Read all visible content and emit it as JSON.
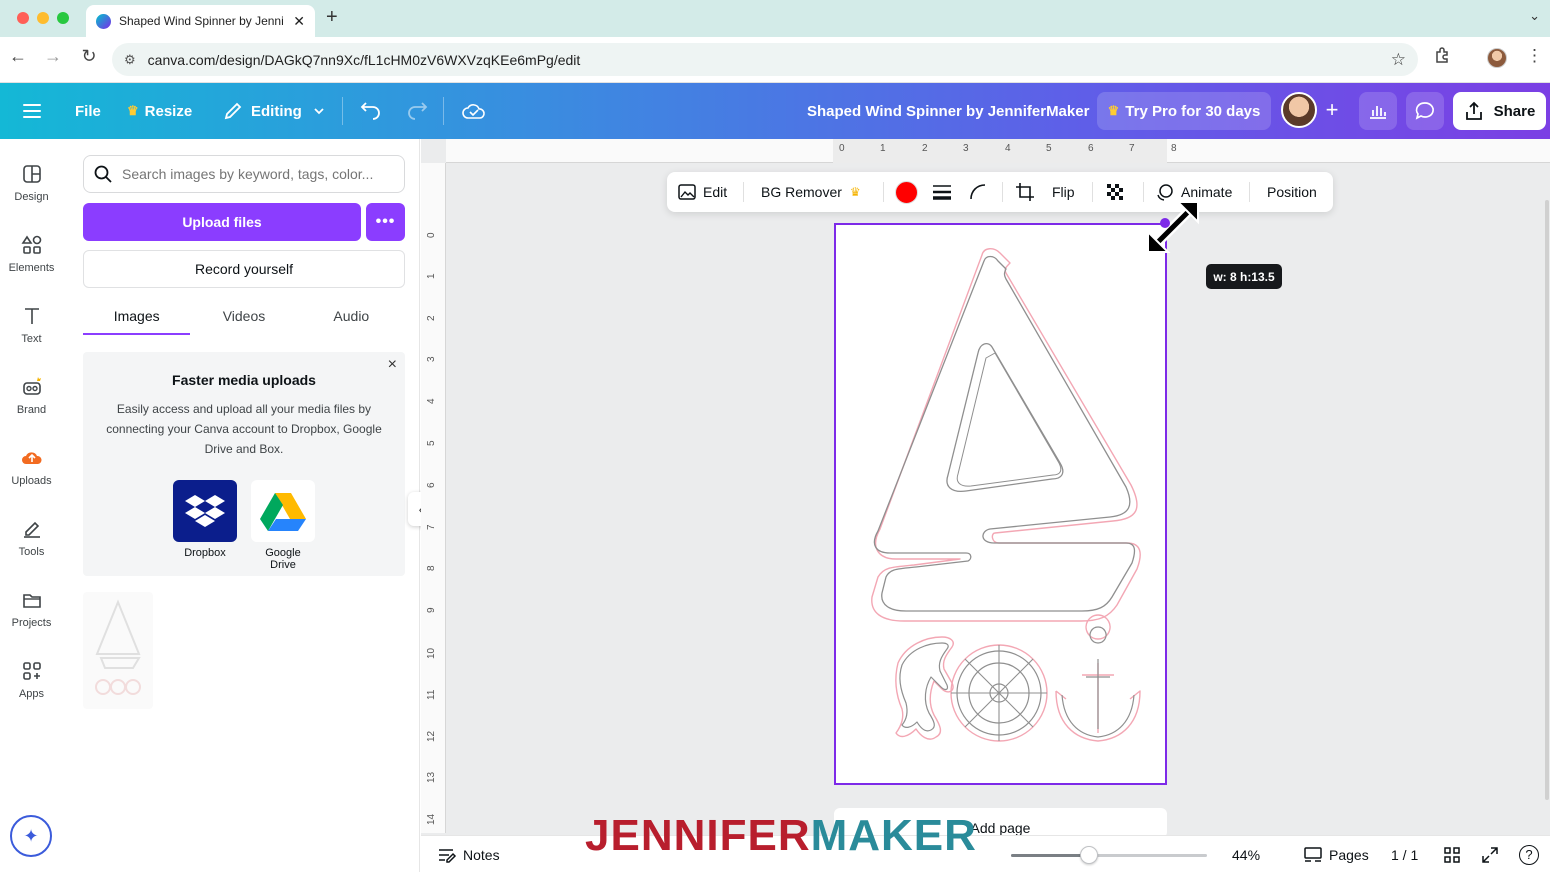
{
  "browser": {
    "tab_title": "Shaped Wind Spinner by Jenni",
    "new_tab": "+",
    "url": "canva.com/design/DAGkQ7nn9Xc/fL1cHM0zV6WXVzqKEe6mPg/edit"
  },
  "toolbar": {
    "file": "File",
    "resize": "Resize",
    "editing": "Editing",
    "doc_title": "Shaped Wind Spinner by JenniferMaker",
    "try_pro": "Try Pro for 30 days",
    "plus": "+",
    "share": "Share"
  },
  "rail": {
    "items": [
      {
        "label": "Design",
        "icon": "layout-icon"
      },
      {
        "label": "Elements",
        "icon": "shapes-icon"
      },
      {
        "label": "Text",
        "icon": "text-icon"
      },
      {
        "label": "Brand",
        "icon": "brand-icon"
      },
      {
        "label": "Uploads",
        "icon": "upload-cloud-icon"
      },
      {
        "label": "Tools",
        "icon": "pen-icon"
      },
      {
        "label": "Projects",
        "icon": "folder-icon"
      },
      {
        "label": "Apps",
        "icon": "apps-icon"
      }
    ]
  },
  "panel": {
    "search_placeholder": "Search images by keyword, tags, color...",
    "upload_files": "Upload files",
    "more": "•••",
    "record": "Record yourself",
    "tabs": [
      "Images",
      "Videos",
      "Audio"
    ],
    "promo": {
      "close": "×",
      "title": "Faster media uploads",
      "text": "Easily access and upload all your media files by connecting your Canva account to Dropbox, Google Drive and Box.",
      "dropbox": "Dropbox",
      "gdrive": "Google Drive"
    }
  },
  "canvas_toolbar": {
    "edit": "Edit",
    "bg_remover": "BG Remover",
    "flip": "Flip",
    "animate": "Animate",
    "position": "Position",
    "color": "#ff0000"
  },
  "ruler": {
    "top": [
      "0",
      "1",
      "2",
      "3",
      "4",
      "5",
      "6",
      "7",
      "8"
    ],
    "left": [
      "0",
      "1",
      "2",
      "3",
      "4",
      "5",
      "6",
      "7",
      "8",
      "9",
      "10",
      "11",
      "12",
      "13",
      "14"
    ]
  },
  "canvas": {
    "dimensions": "w: 8 h:13.5",
    "add_page": "Add page"
  },
  "watermark": {
    "part1": "JENNIFER",
    "part2": "MAKER",
    "color1": "#b81e2d",
    "color2": "#2a8b9a"
  },
  "bottom": {
    "notes": "Notes",
    "zoom_value": 0.4,
    "zoom": "44%",
    "pages": "Pages",
    "page_count": "1 / 1",
    "help": "?"
  },
  "colors": {
    "accent": "#8b3dff",
    "selection": "#7d2ae8"
  }
}
